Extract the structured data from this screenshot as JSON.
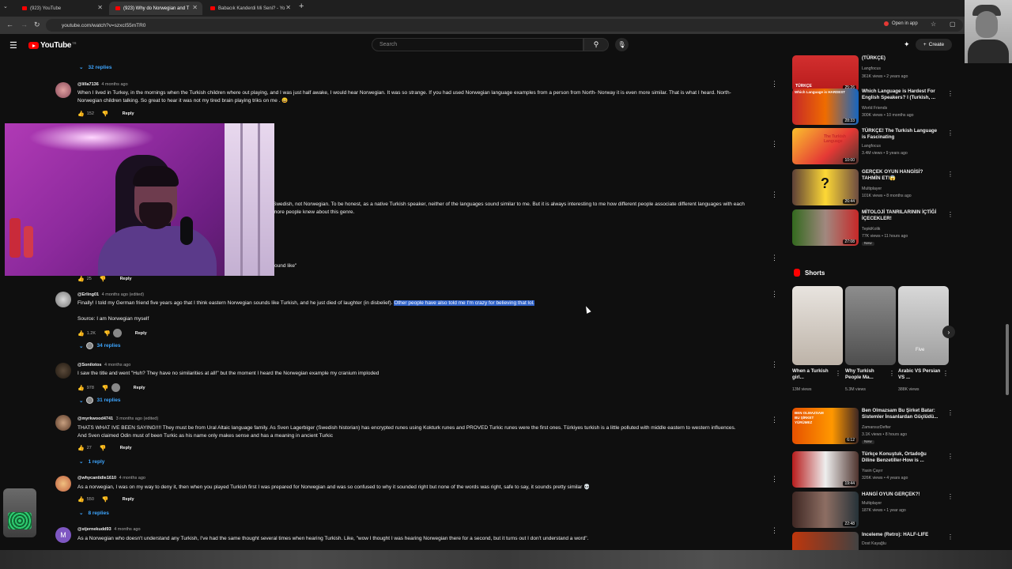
{
  "browser": {
    "tabs": [
      {
        "title": "(923) YouTube",
        "active": false
      },
      {
        "title": "(923) Why do Norwegian and T",
        "active": true
      },
      {
        "title": "Babacık Kanderdi Mi Seni? - Yo",
        "active": false
      }
    ],
    "url": "youtube.com/watch?v=szxcI55mTR0",
    "open_in_app": "Open in app"
  },
  "header": {
    "logo": "YouTube",
    "country": "TR",
    "search_placeholder": "Search",
    "create_label": "Create"
  },
  "comments": {
    "top_replies": "32 replies",
    "items": [
      {
        "handle": "@lilla7136",
        "meta": "4 months ago",
        "text_line1": "When I lived in Turkey, in the mornings when the Turkish children where out playing, and I was just half awake, I would hear Norwegian. It was so strange. If you had used Norwegian language examples from a person from North- Norway it is even more similar. That is what I heard. North-",
        "text_line2": "Norwegian children talking. So great to hear it was not my tired brain playing triks on me . 😄",
        "likes": "152",
        "reply": "Reply"
      },
      {
        "text_line1": "Swedish, not Norwegian. To be honest, as a native Turkish speaker, neither of the languages sound similar to me. But it is always interesting to me how different people associate different languages with each",
        "text_line2": "more people knew about this genre.",
        "text_tail": "ound like\"",
        "likes": "25",
        "reply": "Reply"
      },
      {
        "handle": "@Erling01",
        "meta": "4 months ago (edited)",
        "text_plain": "Finally! I told my German friend five years ago that I think eastern Norwegian sounds like Turkish, and he just died of laughter (in disbelief). ",
        "text_highlight": "Other people have also told me I'm crazy for believing that lol.",
        "text_line2": "Source: I am Norwegian myself",
        "likes": "1.2K",
        "reply": "Reply",
        "replies": "34 replies"
      },
      {
        "handle": "@Sonilotos",
        "meta": "4 months ago",
        "text_line1": "I saw the title and went \"Huh? They have no similarities at all!\" but the moment I heard the Norwegian example my cranium imploded",
        "likes": "978",
        "reply": "Reply",
        "replies": "31 replies"
      },
      {
        "handle": "@myrkwood4741",
        "meta": "3 months ago (edited)",
        "text_line1": "THATS WHAT IVE BEEN SAYING!!!! They must be from Ural Altaic language family. As Sven Lagerbiger (Swedish historian) has  encrypted runes using Kokturk runes and PROVED Turkic runes were the first ones. Türkiyes turkish is a little polluted with middle eastern to western influences.",
        "text_line2": "And Sven claimed Odin must of been Turkic as his name only makes sense and has a meaning in ancient Turkic",
        "likes": "27",
        "reply": "Reply",
        "replies": "1 reply"
      },
      {
        "handle": "@whycantidie1610",
        "meta": "4 months ago",
        "text_line1": "As a norwegian, I was on my way to deny it, then when you played Turkish first I was prepared for Norwegian and was so confused to why it sounded right but none of the words was right, safe to say, it sounds pretty similar 💀",
        "likes": "550",
        "reply": "Reply",
        "replies": "8 replies"
      },
      {
        "handle": "@stjernekudd93",
        "meta": "4 months ago",
        "avatar_letter": "M",
        "text_line1": "As a Norwegian who doesn't understand any Turkish, I've had the same thought several times when hearing Turkish. Like, \"wow I thought I was hearing Norwegian there for a second, but it turns out I don't understand a word\"."
      }
    ]
  },
  "sidebar": {
    "videos": [
      {
        "title": "(TÜRKÇE)",
        "channel": "Langfocus",
        "stats": "361K views • 2 years ago",
        "duration": "25:26",
        "thumb_text": "TÜRKÇE"
      },
      {
        "title": "Which Language is Hardest For English Speakers? I (Turkish, ...",
        "channel": "World Friends",
        "stats": "300K views • 10 months ago",
        "duration": "28:33",
        "thumb_text": "Which Language is HARDEST"
      },
      {
        "title": "TÜRKÇE! The Turkish Language is Fascinating",
        "channel": "Langfocus",
        "stats": "3.4M views • 9 years ago",
        "duration": "10:00",
        "thumb_text": "The Turkish Language"
      },
      {
        "title": "GERÇEK OYUN HANGİSİ? TAHMİN ET!😱 ",
        "channel": "Multiplayer",
        "stats": "101K views • 8 months ago",
        "duration": "26:44",
        "thumb_text": "?"
      },
      {
        "title": "MİTOLOJİ TANRILARININ İÇTİĞİ İÇECEKLER!",
        "channel": "TepkiKolik",
        "stats": "77K views • 11 hours ago",
        "duration": "27:08",
        "badge": "New"
      },
      {
        "title": "Ben Olmazsam Bu Şirket Batar: Sistemler İnsanlardan Güçlüdü...",
        "channel": "ZamansızDefter",
        "stats": "3.1K views • 8 hours ago",
        "duration": "6:12",
        "badge": "New",
        "thumb_text": "BEN OLMAZSAM BU ŞİRKET YÜRÜMEZ"
      },
      {
        "title": "Türkçe Konuştuk, Ortadoğu Diline Benzetiller-How is ...",
        "channel": "Yasin Çayır",
        "stats": "326K views • 4 years ago",
        "duration": "19:44"
      },
      {
        "title": "HANGİ OYUN GERÇEK?!",
        "channel": "Multiplayer",
        "stats": "187K views • 1 year ago",
        "duration": "22:48"
      },
      {
        "title": "Inceleme (Retro): HALF-LIFE",
        "channel": "Dost Kayağlu",
        "stats": ""
      }
    ],
    "shorts_label": "Shorts",
    "shorts": [
      {
        "title": "When a Turkish girl...",
        "views": "13M views"
      },
      {
        "title": "Why Turkish People Ma...",
        "views": "5.3M views"
      },
      {
        "title": "Arabic VS Persian VS ...",
        "views": "388K views",
        "tag": "Five"
      }
    ]
  },
  "colors": {
    "accent": "#3ea6ff",
    "brand": "#ff0000",
    "highlight": "#2f62c9"
  }
}
